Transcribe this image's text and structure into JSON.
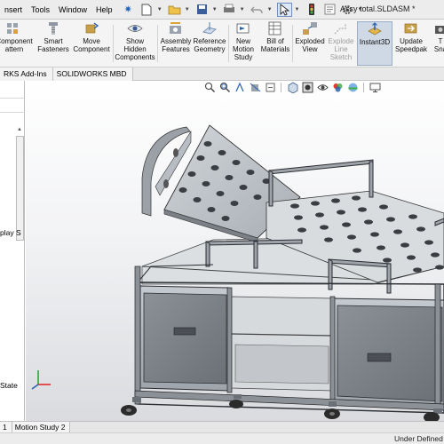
{
  "menubar": {
    "items": [
      "nsert",
      "Tools",
      "Window",
      "Help"
    ],
    "document_title": "Assy total.SLDASM *"
  },
  "ribbon": {
    "buttons": [
      {
        "label": "Component\nattern",
        "icon": "pattern-icon"
      },
      {
        "label": "Smart\nFasteners",
        "icon": "fastener-icon"
      },
      {
        "label": "Move\nComponent",
        "icon": "move-component-icon"
      },
      {
        "label": "Show\nHidden\nComponents",
        "icon": "show-hidden-icon"
      },
      {
        "label": "Assembly\nFeatures",
        "icon": "assembly-features-icon"
      },
      {
        "label": "Reference\nGeometry",
        "icon": "reference-geometry-icon"
      },
      {
        "label": "New\nMotion\nStudy",
        "icon": "motion-study-icon"
      },
      {
        "label": "Bill of\nMaterials",
        "icon": "bom-icon"
      },
      {
        "label": "Exploded\nView",
        "icon": "exploded-view-icon"
      },
      {
        "label": "Explode\nLine\nSketch",
        "icon": "explode-line-icon"
      },
      {
        "label": "Instant3D",
        "icon": "instant3d-icon"
      },
      {
        "label": "Update\nSpeedpak",
        "icon": "speedpak-icon"
      },
      {
        "label": "T\nSna",
        "icon": "snapshot-icon"
      }
    ]
  },
  "tabs": [
    "RKS Add-Ins",
    "SOLIDWORKS MBD"
  ],
  "left_panel": {
    "text_display": "play S",
    "text_state": "State"
  },
  "bottom_tabs": [
    "1",
    "Motion Study 2"
  ],
  "status": {
    "text": "Under Defined"
  },
  "colors": {
    "metal_frame": "#8c9198",
    "panel_light": "#b9bec4",
    "panel_dark": "#6b7077",
    "wheel": "#2b2b2b",
    "active_ribbon": "#cfd9e6"
  }
}
